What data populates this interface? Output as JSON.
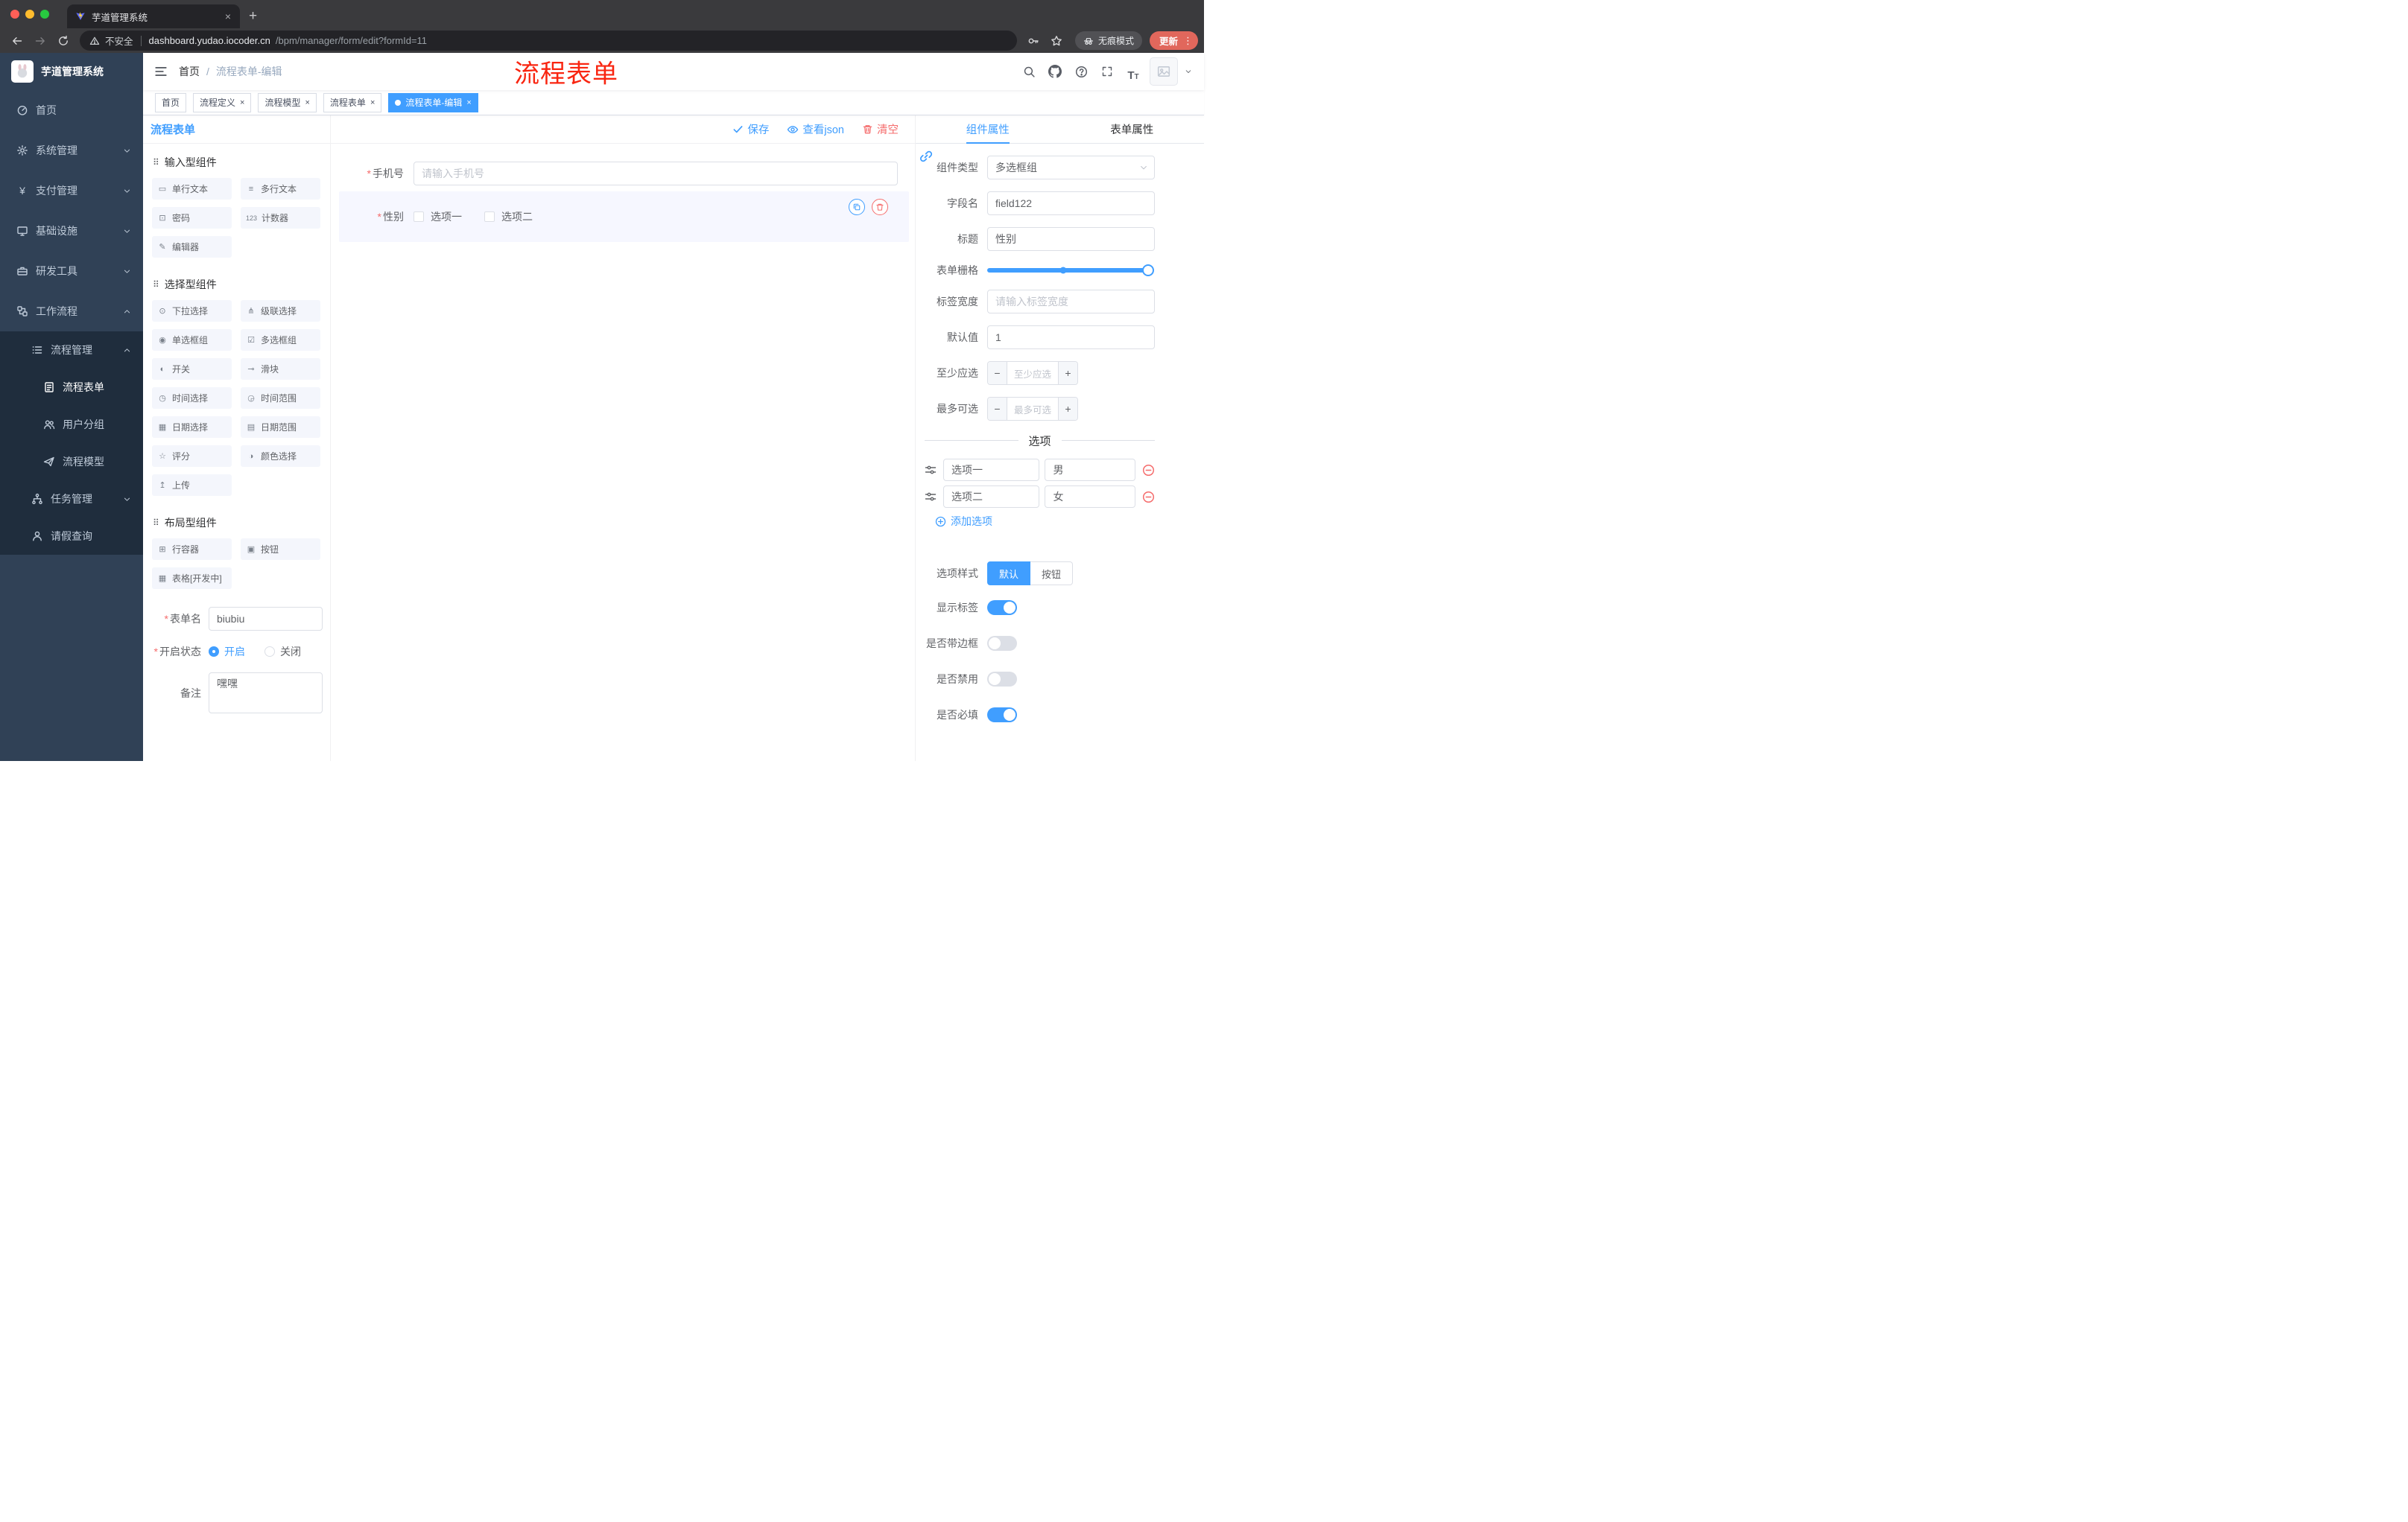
{
  "colors": {
    "accent": "#409eff",
    "danger": "#f56c6c",
    "annotation_red": "#f92510",
    "sidebar_bg": "#304156",
    "submenu_bg": "#1f2d3d"
  },
  "browser": {
    "tab_title": "芋道管理系统",
    "new_tab_glyph": "+",
    "security_label": "不安全",
    "url_host": "dashboard.yudao.iocoder.cn",
    "url_path": "/bpm/manager/form/edit?formId=11",
    "incognito_label": "无痕模式",
    "update_label": "更新",
    "menu_dots_glyph": "⋮"
  },
  "sidebar": {
    "logo_title": "芋道管理系统",
    "items": [
      {
        "label": "首页",
        "icon": "dashboard-icon"
      },
      {
        "label": "系统管理",
        "icon": "gear-icon"
      },
      {
        "label": "支付管理",
        "icon": "yen-icon",
        "glyph": "¥"
      },
      {
        "label": "基础设施",
        "icon": "monitor-icon"
      },
      {
        "label": "研发工具",
        "icon": "toolbox-icon"
      },
      {
        "label": "工作流程",
        "icon": "workflow-icon"
      },
      {
        "label": "流程管理",
        "icon": "list-icon"
      },
      {
        "label": "流程表单",
        "icon": "document-icon"
      },
      {
        "label": "用户分组",
        "icon": "users-icon"
      },
      {
        "label": "流程模型",
        "icon": "paper-plane-icon"
      },
      {
        "label": "任务管理",
        "icon": "tree-icon"
      },
      {
        "label": "请假查询",
        "icon": "user-icon"
      }
    ]
  },
  "navbar": {
    "breadcrumb_home": "首页",
    "breadcrumb_separator": "/",
    "breadcrumb_current": "流程表单-编辑",
    "annotation": "流程表单"
  },
  "tags": [
    {
      "label": "首页"
    },
    {
      "label": "流程定义"
    },
    {
      "label": "流程模型"
    },
    {
      "label": "流程表单"
    },
    {
      "label": "流程表单-编辑"
    }
  ],
  "designer": {
    "panel_title": "流程表单",
    "groups": [
      {
        "title": "输入型组件",
        "items": [
          {
            "glyph": "▭",
            "label": "单行文本"
          },
          {
            "glyph": "≡",
            "label": "多行文本"
          },
          {
            "glyph": "⊡",
            "label": "密码"
          },
          {
            "glyph": "123",
            "label": "计数器"
          },
          {
            "glyph": "✎",
            "label": "编辑器"
          }
        ]
      },
      {
        "title": "选择型组件",
        "items": [
          {
            "glyph": "⊙",
            "label": "下拉选择"
          },
          {
            "glyph": "⋔",
            "label": "级联选择"
          },
          {
            "glyph": "◉",
            "label": "单选框组"
          },
          {
            "glyph": "☑",
            "label": "多选框组"
          },
          {
            "glyph": "◐",
            "label": "开关"
          },
          {
            "glyph": "⊸",
            "label": "滑块"
          },
          {
            "glyph": "◷",
            "label": "时间选择"
          },
          {
            "glyph": "◶",
            "label": "时间范围"
          },
          {
            "glyph": "▦",
            "label": "日期选择"
          },
          {
            "glyph": "▤",
            "label": "日期范围"
          },
          {
            "glyph": "☆",
            "label": "评分"
          },
          {
            "glyph": "◑",
            "label": "颜色选择"
          },
          {
            "glyph": "↥",
            "label": "上传"
          }
        ]
      },
      {
        "title": "布局型组件",
        "items": [
          {
            "glyph": "⊞",
            "label": "行容器"
          },
          {
            "glyph": "▣",
            "label": "按钮"
          },
          {
            "glyph": "▦",
            "label": "表格[开发中]"
          }
        ]
      }
    ],
    "form": {
      "name_label": "表单名",
      "name_value": "biubiu",
      "status_label": "开启状态",
      "status_on": "开启",
      "status_off": "关闭",
      "remark_label": "备注",
      "remark_value": "嘿嘿"
    }
  },
  "canvas": {
    "save_label": "保存",
    "view_json_label": "查看json",
    "clear_label": "清空",
    "phone_label": "手机号",
    "phone_placeholder": "请输入手机号",
    "gender_label": "性别",
    "gender_option1": "选项一",
    "gender_option2": "选项二"
  },
  "props": {
    "tab_component": "组件属性",
    "tab_form": "表单属性",
    "component_type_label": "组件类型",
    "component_type_value": "多选框组",
    "field_name_label": "字段名",
    "field_name_value": "field122",
    "title_label": "标题",
    "title_value": "性别",
    "grid_label": "表单栅格",
    "label_width_label": "标签宽度",
    "label_width_placeholder": "请输入标签宽度",
    "default_label": "默认值",
    "default_value": "1",
    "min_label": "至少应选",
    "min_placeholder": "至少应选",
    "max_label": "最多可选",
    "max_placeholder": "最多可选",
    "options_divider": "选项",
    "options": [
      {
        "name": "选项一",
        "value": "男"
      },
      {
        "name": "选项二",
        "value": "女"
      }
    ],
    "add_option_label": "添加选项",
    "option_style_label": "选项样式",
    "option_style_default": "默认",
    "option_style_button": "按钮",
    "show_label_label": "显示标签",
    "show_label_on": true,
    "border_label": "是否带边框",
    "border_on": false,
    "disabled_label": "是否禁用",
    "disabled_on": false,
    "required_label": "是否必填",
    "required_on": true
  }
}
